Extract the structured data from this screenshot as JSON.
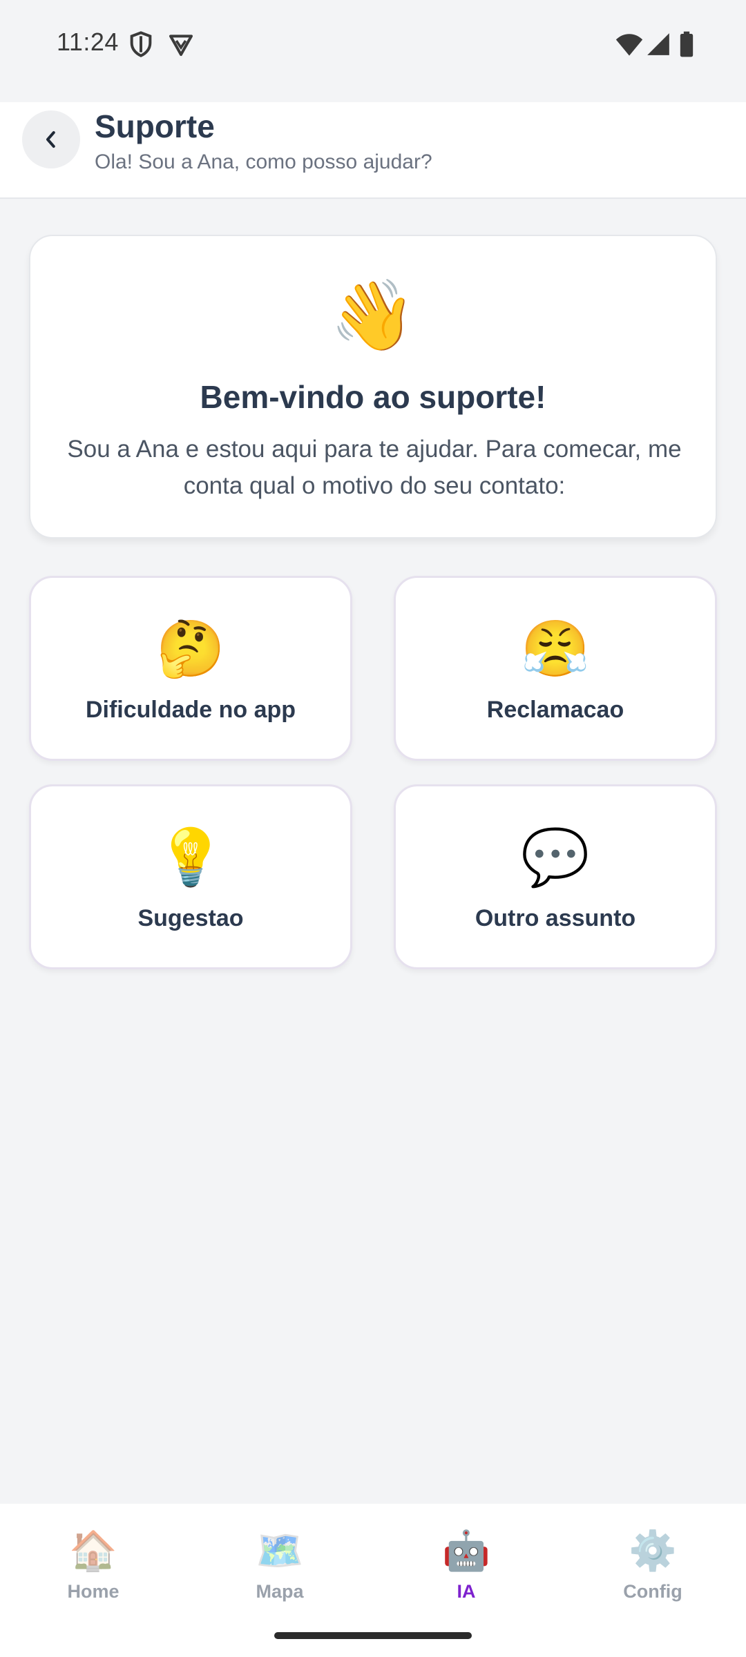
{
  "status_bar": {
    "time": "11:24",
    "icons": [
      "shield-icon",
      "vpn-icon",
      "wifi-icon",
      "signal-icon",
      "battery-icon"
    ]
  },
  "header": {
    "back_icon": "‹",
    "title": "Suporte",
    "subtitle": "Ola! Sou a Ana, como posso ajudar?"
  },
  "welcome": {
    "emoji": "👋",
    "title": "Bem-vindo ao suporte!",
    "text": "Sou a Ana e estou aqui para te ajudar. Para comecar, me conta qual o motivo do seu contato:"
  },
  "options": [
    {
      "emoji": "🤔",
      "label": "Dificuldade no app"
    },
    {
      "emoji": "😤",
      "label": "Reclamacao"
    },
    {
      "emoji": "💡",
      "label": "Sugestao"
    },
    {
      "emoji": "💬",
      "label": "Outro assunto"
    }
  ],
  "bottom_nav": {
    "active": "IA",
    "active_color": "#7e22ce",
    "items": [
      {
        "icon": "🏠",
        "label": "Home"
      },
      {
        "icon": "🗺️",
        "label": "Mapa"
      },
      {
        "icon": "🤖",
        "label": "IA"
      },
      {
        "icon": "⚙️",
        "label": "Config"
      }
    ]
  }
}
